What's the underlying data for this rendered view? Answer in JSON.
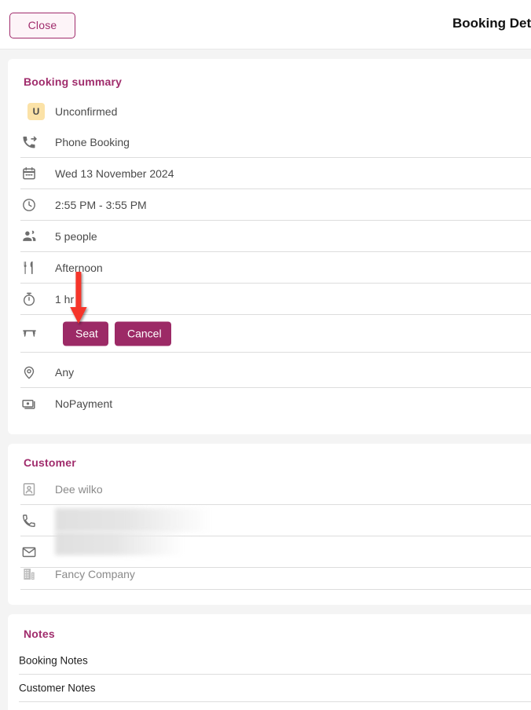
{
  "header": {
    "close_label": "Close",
    "title": "Booking Details"
  },
  "colors": {
    "brand": "#a02c6c",
    "button": "#9c2a66",
    "badge_bg": "#fbe2a7",
    "page_bg": "#f4f4f4",
    "arrow": "#f5352c"
  },
  "booking_summary": {
    "title": "Booking summary",
    "status": {
      "badge": "U",
      "label": "Unconfirmed"
    },
    "rows": [
      {
        "icon": "phone-forwarded-icon",
        "value": "Phone Booking"
      },
      {
        "icon": "calendar-icon",
        "value": "Wed 13 November 2024"
      },
      {
        "icon": "clock-icon",
        "value": "2:55 PM - 3:55 PM"
      },
      {
        "icon": "people-icon",
        "value": "5 people"
      },
      {
        "icon": "restaurant-icon",
        "value": "Afternoon"
      },
      {
        "icon": "timer-icon",
        "value": "1 hr"
      }
    ],
    "actions": {
      "icon": "table-icon",
      "seat_label": "Seat",
      "cancel_label": "Cancel"
    },
    "area": {
      "icon": "location-pin-icon",
      "value": "Any"
    },
    "payment": {
      "icon": "money-icon",
      "value": "NoPayment"
    }
  },
  "customer": {
    "title": "Customer",
    "name": {
      "icon": "contact-card-icon",
      "value": "Dee wilko"
    },
    "phone": {
      "icon": "phone-icon",
      "value": ""
    },
    "email": {
      "icon": "email-icon",
      "value": ""
    },
    "company": {
      "icon": "building-icon",
      "value": "Fancy Company"
    }
  },
  "notes": {
    "title": "Notes",
    "items": [
      {
        "label": "Booking Notes"
      },
      {
        "label": "Customer Notes"
      }
    ]
  },
  "annotation": {
    "arrow": "red-down-arrow",
    "points_at": "Seat"
  }
}
